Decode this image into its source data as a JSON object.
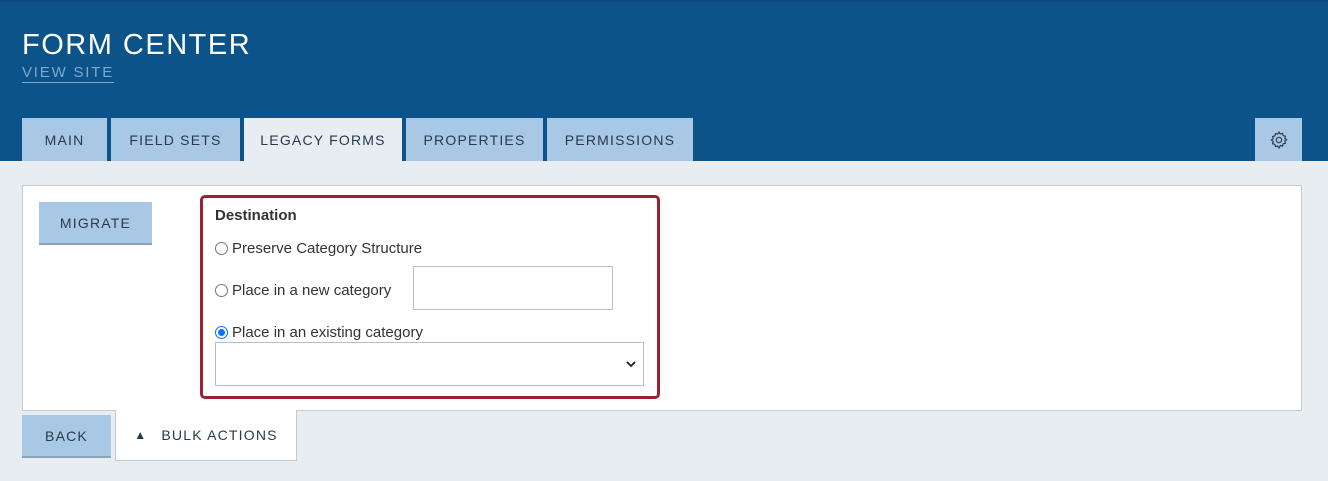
{
  "header": {
    "title": "FORM CENTER",
    "view_site": "VIEW SITE"
  },
  "tabs": [
    {
      "label": "MAIN",
      "active": false
    },
    {
      "label": "FIELD SETS",
      "active": false
    },
    {
      "label": "LEGACY FORMS",
      "active": true
    },
    {
      "label": "PROPERTIES",
      "active": false
    },
    {
      "label": "PERMISSIONS",
      "active": false
    }
  ],
  "toolbar": {
    "migrate_label": "MIGRATE",
    "back_label": "BACK",
    "bulk_actions_label": "BULK ACTIONS"
  },
  "destination": {
    "title": "Destination",
    "options": [
      {
        "label": "Preserve Category Structure",
        "checked": false
      },
      {
        "label": "Place in a new category",
        "checked": false
      },
      {
        "label": "Place in an existing category",
        "checked": true
      }
    ],
    "new_category_value": "",
    "existing_category_selected": ""
  },
  "icons": {
    "settings": "gear-icon",
    "bulk_toggle": "triangle-up-icon",
    "select_arrow": "chevron-down-icon"
  },
  "colors": {
    "header_bg": "#0b5388",
    "tab_bg": "#a9c8e6",
    "highlight_border": "#9b2230",
    "radio_checked": "#0075ff"
  }
}
